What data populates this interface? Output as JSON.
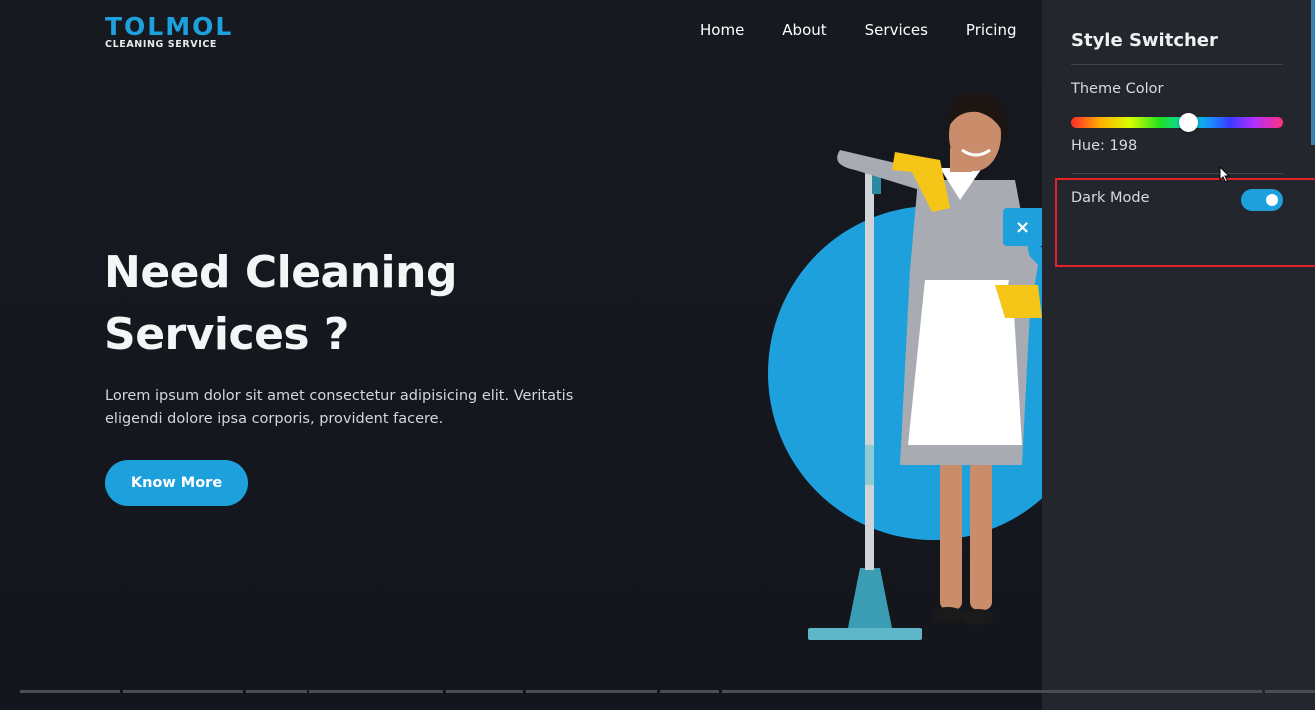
{
  "header": {
    "logo": "TOLMOL",
    "logo_sub": "CLEANING SERVICE",
    "nav": [
      "Home",
      "About",
      "Services",
      "Pricing"
    ]
  },
  "hero": {
    "title": "Need Cleaning Services ?",
    "text": "Lorem ipsum dolor sit amet consectetur adipisicing elit. Veritatis eligendi dolore ipsa corporis, provident facere.",
    "button": "Know More"
  },
  "close_icon": "×",
  "switcher": {
    "title": "Style Switcher",
    "theme_label": "Theme Color",
    "hue_text": "Hue: 198",
    "hue_value": 198,
    "dark_mode_label": "Dark Mode",
    "dark_mode_on": true
  },
  "colors": {
    "accent": "#1ea0dc",
    "background": "#15181e",
    "panel": "#23272d",
    "highlight": "#e3222a"
  },
  "icons": [
    "close-icon",
    "cursor-icon"
  ]
}
